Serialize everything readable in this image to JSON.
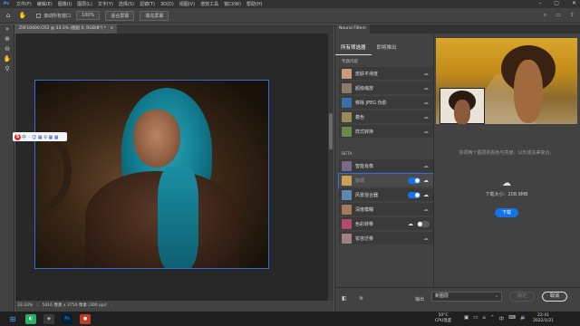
{
  "menubar": {
    "app_icon": "Ps",
    "items": [
      "文件(F)",
      "编辑(E)",
      "图像(I)",
      "图层(L)",
      "文字(Y)",
      "选择(S)",
      "滤镜(T)",
      "3D(D)",
      "视图(V)",
      "增效工具",
      "窗口(W)",
      "帮助(H)"
    ]
  },
  "options": {
    "scroll_all_label": "滚动所有窗口",
    "zoom_100": "100%",
    "fit_screen": "适合屏幕",
    "fill_screen": "填充屏幕"
  },
  "document": {
    "tab_title": "ZXFL0400.CR2 @ 33.3% (图层 0, RGB/8*) *",
    "status_zoom": "33.33%",
    "status_info": "5416 像素 x 3750 像素 (300 ppi)"
  },
  "ime": {
    "logo": "S",
    "chars": "中 ◦ ☺ ▦ ♀ ▦ ▦"
  },
  "neural_filters": {
    "panel_tab": "Neural Filters",
    "subtabs": [
      "所有筛选器",
      "即将推出"
    ],
    "featured_label": "专题内容",
    "featured": [
      {
        "label": "皮肤平滑度",
        "thumb": "#c99a7a"
      },
      {
        "label": "超级缩放",
        "thumb": "#8c7a6a"
      },
      {
        "label": "移除 JPEG 伪影",
        "thumb": "#3a6ea8"
      },
      {
        "label": "着色",
        "thumb": "#9a8a5a"
      },
      {
        "label": "样式转换",
        "thumb": "#6a8a4a"
      }
    ],
    "beta_label": "BETA",
    "beta": [
      {
        "label": "智能肖像",
        "thumb": "#7a6a8a",
        "state": "cloud"
      },
      {
        "label": "协调",
        "thumb": "#c9a05a",
        "state": "on",
        "selected": true
      },
      {
        "label": "风景混合器",
        "thumb": "#5a8ab4",
        "state": "on"
      },
      {
        "label": "深度模糊",
        "thumb": "#a07a5a",
        "state": "cloud"
      },
      {
        "label": "色彩转移",
        "thumb": "#b44a6a",
        "state": "off"
      },
      {
        "label": "妆容迁移",
        "thumb": "#a08080",
        "state": "cloud"
      }
    ],
    "hint": "协调两个图层的颜色与亮度，以形成完美复合。",
    "download_size": "下载大小：208.9MB",
    "download_button": "下载",
    "output_label": "输出",
    "output_value": "新图层",
    "ok_button": "确定",
    "cancel_button": "取消"
  },
  "taskbar": {
    "weather_temp": "50°C",
    "weather_label": "CPU温度",
    "ime_lang": "中",
    "time": "22:41",
    "date": "2022/1/21"
  }
}
